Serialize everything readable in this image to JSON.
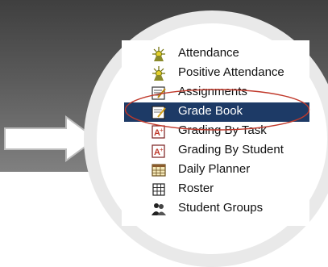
{
  "colors": {
    "banner_top": "#3f3f3f",
    "banner_bottom": "#808080",
    "selection_bg": "#1d3a66",
    "highlight_ellipse": "#c0392b"
  },
  "menu": {
    "items": [
      {
        "label": "Attendance",
        "icon": "attendance-icon"
      },
      {
        "label": "Positive Attendance",
        "icon": "attendance-icon"
      },
      {
        "label": "Assignments",
        "icon": "assignments-icon"
      },
      {
        "label": "Grade Book",
        "icon": "gradebook-icon",
        "selected": true
      },
      {
        "label": "Grading By Task",
        "icon": "grading-icon"
      },
      {
        "label": "Grading By Student",
        "icon": "grading-icon"
      },
      {
        "label": "Daily Planner",
        "icon": "planner-icon"
      },
      {
        "label": "Roster",
        "icon": "roster-icon"
      },
      {
        "label": "Student Groups",
        "icon": "student-groups-icon"
      }
    ]
  },
  "decorations": {
    "pointer_arrow": "right-arrow-icon",
    "highlight": "ellipse-highlight"
  }
}
